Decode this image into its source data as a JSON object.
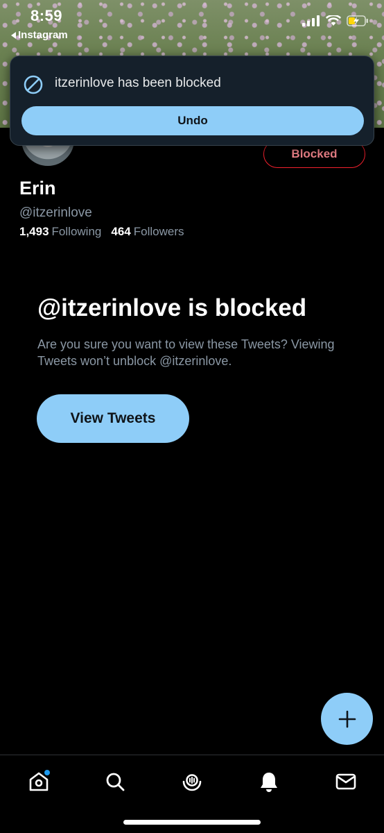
{
  "status_bar": {
    "time": "8:59",
    "back_app": "Instagram"
  },
  "toast": {
    "message": "itzerinlove has been blocked",
    "undo_label": "Undo",
    "icon": "block-icon"
  },
  "profile": {
    "name": "Erin",
    "handle": "@itzerinlove",
    "following_count": "1,493",
    "following_label": "Following",
    "followers_count": "464",
    "followers_label": "Followers",
    "blocked_button_label": "Blocked"
  },
  "blocked_notice": {
    "title": "@itzerinlove is blocked",
    "description": "Are you sure you want to view these Tweets? Viewing Tweets won’t unblock @itzerinlove.",
    "view_button_label": "View Tweets"
  },
  "tab_bar": {
    "items": [
      "home-icon",
      "search-icon",
      "spaces-icon",
      "notifications-icon",
      "messages-icon"
    ]
  },
  "colors": {
    "accent": "#8ecdf8",
    "blocked_red": "#f4212e",
    "background": "#000000",
    "muted_text": "#8b98a5"
  }
}
